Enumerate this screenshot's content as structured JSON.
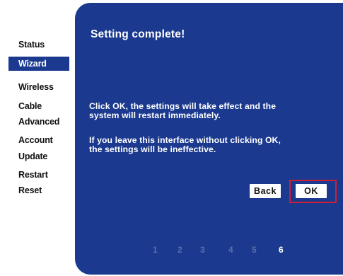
{
  "sidebar": {
    "items": [
      {
        "label": "Status"
      },
      {
        "label": "Wizard"
      },
      {
        "label": "Wireless"
      },
      {
        "label": "Cable"
      },
      {
        "label": "Advanced"
      },
      {
        "label": "Account"
      },
      {
        "label": "Update"
      },
      {
        "label": "Restart"
      },
      {
        "label": "Reset"
      }
    ],
    "active_item": "Wizard"
  },
  "panel": {
    "title": "Setting complete!",
    "message1_line1": "Click OK, the settings will take effect and the",
    "message1_line2": "system will restart immediately.",
    "message2_line1": "If you leave this interface without clicking OK,",
    "message2_line2": "the settings will be ineffective.",
    "back_label": "Back",
    "ok_label": "OK"
  },
  "steps": {
    "items": [
      "1",
      "2",
      "3",
      "4",
      "5",
      "6"
    ],
    "current": "6"
  },
  "colors": {
    "panel": "#1b3a8f",
    "highlight_border": "#cf1f2f",
    "inactive_step": "#5a6fa8"
  }
}
